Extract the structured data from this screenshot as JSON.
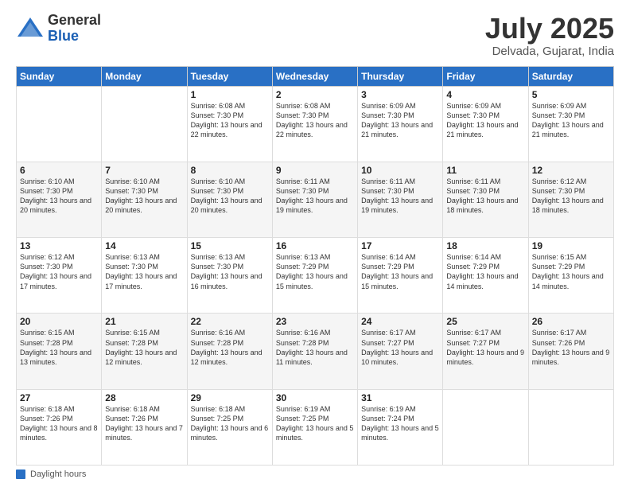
{
  "logo": {
    "general": "General",
    "blue": "Blue"
  },
  "title": "July 2025",
  "subtitle": "Delvada, Gujarat, India",
  "days_of_week": [
    "Sunday",
    "Monday",
    "Tuesday",
    "Wednesday",
    "Thursday",
    "Friday",
    "Saturday"
  ],
  "footer_label": "Daylight hours",
  "weeks": [
    [
      {
        "num": "",
        "detail": ""
      },
      {
        "num": "",
        "detail": ""
      },
      {
        "num": "1",
        "detail": "Sunrise: 6:08 AM\nSunset: 7:30 PM\nDaylight: 13 hours\nand 22 minutes."
      },
      {
        "num": "2",
        "detail": "Sunrise: 6:08 AM\nSunset: 7:30 PM\nDaylight: 13 hours\nand 22 minutes."
      },
      {
        "num": "3",
        "detail": "Sunrise: 6:09 AM\nSunset: 7:30 PM\nDaylight: 13 hours\nand 21 minutes."
      },
      {
        "num": "4",
        "detail": "Sunrise: 6:09 AM\nSunset: 7:30 PM\nDaylight: 13 hours\nand 21 minutes."
      },
      {
        "num": "5",
        "detail": "Sunrise: 6:09 AM\nSunset: 7:30 PM\nDaylight: 13 hours\nand 21 minutes."
      }
    ],
    [
      {
        "num": "6",
        "detail": "Sunrise: 6:10 AM\nSunset: 7:30 PM\nDaylight: 13 hours\nand 20 minutes."
      },
      {
        "num": "7",
        "detail": "Sunrise: 6:10 AM\nSunset: 7:30 PM\nDaylight: 13 hours\nand 20 minutes."
      },
      {
        "num": "8",
        "detail": "Sunrise: 6:10 AM\nSunset: 7:30 PM\nDaylight: 13 hours\nand 20 minutes."
      },
      {
        "num": "9",
        "detail": "Sunrise: 6:11 AM\nSunset: 7:30 PM\nDaylight: 13 hours\nand 19 minutes."
      },
      {
        "num": "10",
        "detail": "Sunrise: 6:11 AM\nSunset: 7:30 PM\nDaylight: 13 hours\nand 19 minutes."
      },
      {
        "num": "11",
        "detail": "Sunrise: 6:11 AM\nSunset: 7:30 PM\nDaylight: 13 hours\nand 18 minutes."
      },
      {
        "num": "12",
        "detail": "Sunrise: 6:12 AM\nSunset: 7:30 PM\nDaylight: 13 hours\nand 18 minutes."
      }
    ],
    [
      {
        "num": "13",
        "detail": "Sunrise: 6:12 AM\nSunset: 7:30 PM\nDaylight: 13 hours\nand 17 minutes."
      },
      {
        "num": "14",
        "detail": "Sunrise: 6:13 AM\nSunset: 7:30 PM\nDaylight: 13 hours\nand 17 minutes."
      },
      {
        "num": "15",
        "detail": "Sunrise: 6:13 AM\nSunset: 7:30 PM\nDaylight: 13 hours\nand 16 minutes."
      },
      {
        "num": "16",
        "detail": "Sunrise: 6:13 AM\nSunset: 7:29 PM\nDaylight: 13 hours\nand 15 minutes."
      },
      {
        "num": "17",
        "detail": "Sunrise: 6:14 AM\nSunset: 7:29 PM\nDaylight: 13 hours\nand 15 minutes."
      },
      {
        "num": "18",
        "detail": "Sunrise: 6:14 AM\nSunset: 7:29 PM\nDaylight: 13 hours\nand 14 minutes."
      },
      {
        "num": "19",
        "detail": "Sunrise: 6:15 AM\nSunset: 7:29 PM\nDaylight: 13 hours\nand 14 minutes."
      }
    ],
    [
      {
        "num": "20",
        "detail": "Sunrise: 6:15 AM\nSunset: 7:28 PM\nDaylight: 13 hours\nand 13 minutes."
      },
      {
        "num": "21",
        "detail": "Sunrise: 6:15 AM\nSunset: 7:28 PM\nDaylight: 13 hours\nand 12 minutes."
      },
      {
        "num": "22",
        "detail": "Sunrise: 6:16 AM\nSunset: 7:28 PM\nDaylight: 13 hours\nand 12 minutes."
      },
      {
        "num": "23",
        "detail": "Sunrise: 6:16 AM\nSunset: 7:28 PM\nDaylight: 13 hours\nand 11 minutes."
      },
      {
        "num": "24",
        "detail": "Sunrise: 6:17 AM\nSunset: 7:27 PM\nDaylight: 13 hours\nand 10 minutes."
      },
      {
        "num": "25",
        "detail": "Sunrise: 6:17 AM\nSunset: 7:27 PM\nDaylight: 13 hours\nand 9 minutes."
      },
      {
        "num": "26",
        "detail": "Sunrise: 6:17 AM\nSunset: 7:26 PM\nDaylight: 13 hours\nand 9 minutes."
      }
    ],
    [
      {
        "num": "27",
        "detail": "Sunrise: 6:18 AM\nSunset: 7:26 PM\nDaylight: 13 hours\nand 8 minutes."
      },
      {
        "num": "28",
        "detail": "Sunrise: 6:18 AM\nSunset: 7:26 PM\nDaylight: 13 hours\nand 7 minutes."
      },
      {
        "num": "29",
        "detail": "Sunrise: 6:18 AM\nSunset: 7:25 PM\nDaylight: 13 hours\nand 6 minutes."
      },
      {
        "num": "30",
        "detail": "Sunrise: 6:19 AM\nSunset: 7:25 PM\nDaylight: 13 hours\nand 5 minutes."
      },
      {
        "num": "31",
        "detail": "Sunrise: 6:19 AM\nSunset: 7:24 PM\nDaylight: 13 hours\nand 5 minutes."
      },
      {
        "num": "",
        "detail": ""
      },
      {
        "num": "",
        "detail": ""
      }
    ]
  ]
}
